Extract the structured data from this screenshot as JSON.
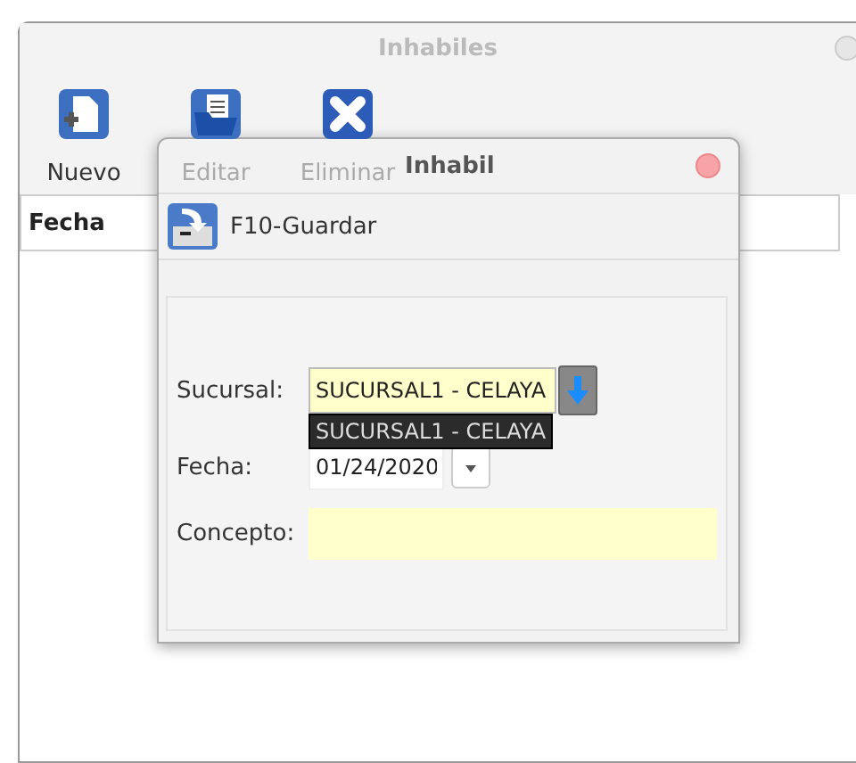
{
  "window": {
    "title": "Inhabiles"
  },
  "toolbar": [
    {
      "label": "Nuevo",
      "kind": "new",
      "disabled": false
    },
    {
      "label": "Editar",
      "kind": "edit",
      "disabled": true
    },
    {
      "label": "Eliminar",
      "kind": "delete",
      "disabled": true
    }
  ],
  "table": {
    "columns": [
      "Fecha"
    ]
  },
  "dialog": {
    "title": "Inhabil",
    "save_button": "F10-Guardar",
    "fields": [
      {
        "label": "Sucursal:",
        "kind": "combo",
        "value": "SUCURSAL1 - CELAYA",
        "tooltip": "SUCURSAL1 - CELAYA"
      },
      {
        "label": "Fecha:",
        "kind": "date",
        "value": "01/24/2020"
      },
      {
        "label": "Concepto:",
        "kind": "text"
      }
    ]
  }
}
